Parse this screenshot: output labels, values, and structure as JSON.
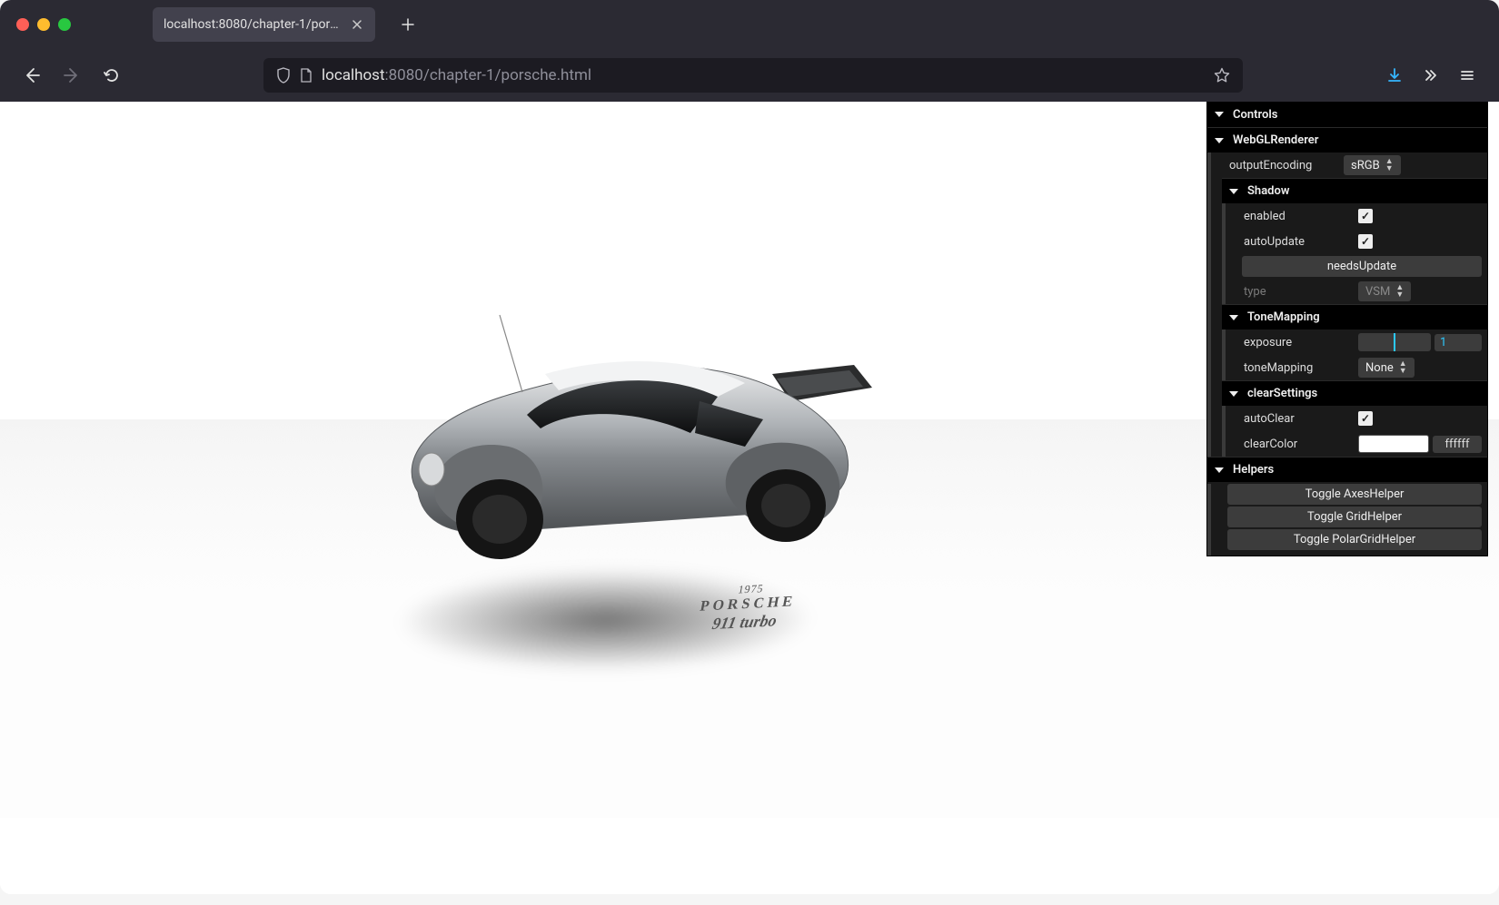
{
  "browser": {
    "tab_title": "localhost:8080/chapter-1/porsche.h",
    "url_host": "localhost",
    "url_path": ":8080/chapter-1/porsche.html"
  },
  "scene": {
    "floor_year": "1975",
    "floor_make": "PORSCHE",
    "floor_model": "911 turbo"
  },
  "gui": {
    "title": "Controls",
    "webgl": {
      "folder": "WebGLRenderer",
      "outputEncoding_label": "outputEncoding",
      "outputEncoding_value": "sRGB"
    },
    "shadow": {
      "folder": "Shadow",
      "enabled_label": "enabled",
      "enabled_checked": true,
      "autoUpdate_label": "autoUpdate",
      "autoUpdate_checked": true,
      "needsUpdate_button": "needsUpdate",
      "type_label": "type",
      "type_value": "VSM"
    },
    "tone": {
      "folder": "ToneMapping",
      "exposure_label": "exposure",
      "exposure_value": "1",
      "exposure_fill_pct": 50,
      "toneMapping_label": "toneMapping",
      "toneMapping_value": "None"
    },
    "clear": {
      "folder": "clearSettings",
      "autoClear_label": "autoClear",
      "autoClear_checked": true,
      "clearColor_label": "clearColor",
      "clearColor_hex": "ffffff",
      "clearColor_swatch": "#ffffff"
    },
    "helpers": {
      "folder": "Helpers",
      "axes_button": "Toggle AxesHelper",
      "grid_button": "Toggle GridHelper",
      "polar_button": "Toggle PolarGridHelper"
    }
  }
}
